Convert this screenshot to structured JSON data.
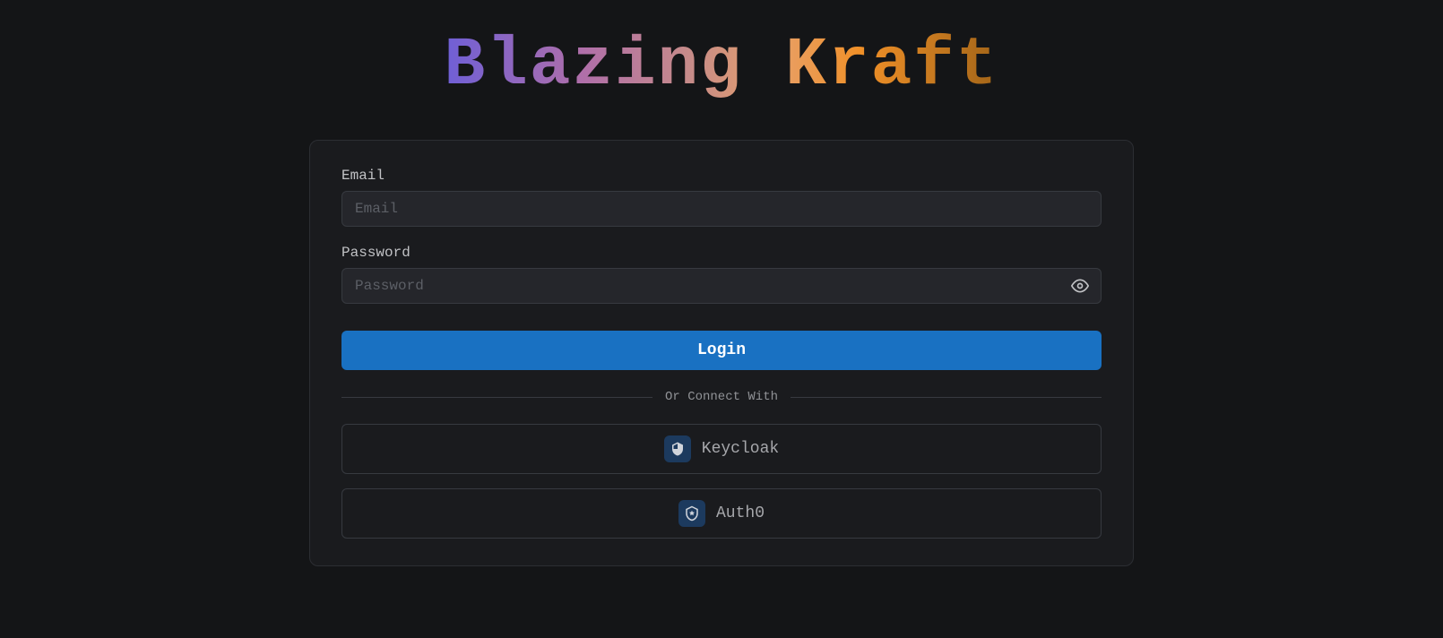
{
  "logo": {
    "text": "Blazing Kraft"
  },
  "form": {
    "email": {
      "label": "Email",
      "placeholder": "Email",
      "value": ""
    },
    "password": {
      "label": "Password",
      "placeholder": "Password",
      "value": ""
    },
    "login_button": "Login",
    "divider_text": "Or Connect With",
    "providers": [
      {
        "name": "Keycloak",
        "icon": "shield-plus"
      },
      {
        "name": "Auth0",
        "icon": "shield-star"
      }
    ]
  }
}
